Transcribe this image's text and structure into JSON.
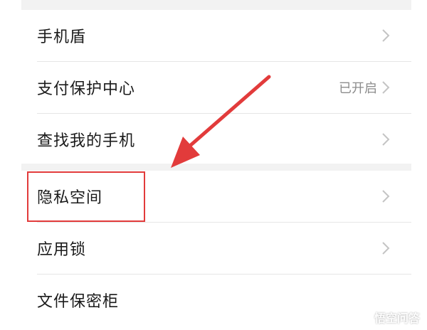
{
  "settings_list": {
    "items": [
      {
        "label": "手机盾",
        "status": ""
      },
      {
        "label": "支付保护中心",
        "status": "已开启"
      },
      {
        "label": "查找我的手机",
        "status": ""
      },
      {
        "label": "隐私空间",
        "status": ""
      },
      {
        "label": "应用锁",
        "status": ""
      },
      {
        "label": "文件保密柜",
        "status": ""
      }
    ]
  },
  "annotation": {
    "highlight_color": "#e23b3b",
    "highlighted_item": "隐私空间"
  },
  "watermark": {
    "text": "悟空问答",
    "icon": "chat-bubble-icon"
  }
}
